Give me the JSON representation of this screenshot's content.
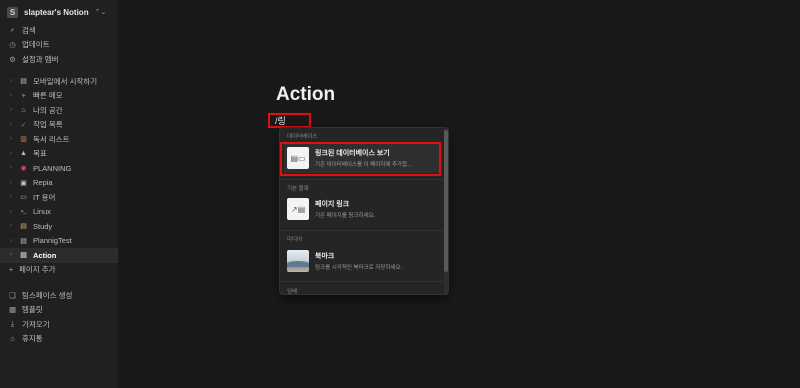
{
  "workspace": {
    "avatar_letter": "S",
    "name": "slaptear's Notion",
    "chevron": "⌃⌄"
  },
  "top_nav": [
    {
      "icon": "search-icon",
      "glyph": "⌕",
      "label": "검색"
    },
    {
      "icon": "clock-icon",
      "glyph": "◷",
      "label": "업데이트"
    },
    {
      "icon": "gear-icon",
      "glyph": "⚙",
      "label": "설정과 멤버"
    }
  ],
  "pages": [
    {
      "icon": "page-icon",
      "glyph": "▤",
      "label": "모바일에서 시작하기"
    },
    {
      "icon": "pin-icon",
      "glyph": "📌",
      "label": "빠른 메모"
    },
    {
      "icon": "house-icon",
      "glyph": "🏠",
      "label": "나의 공간"
    },
    {
      "icon": "check-icon",
      "glyph": "✓",
      "label": "작업 목록"
    },
    {
      "icon": "books-icon",
      "glyph": "📚",
      "label": "독서 리스트"
    },
    {
      "icon": "mountain-icon",
      "glyph": "⛰",
      "label": "목표"
    },
    {
      "icon": "target-icon",
      "glyph": "◉",
      "label": "PLANNING"
    },
    {
      "icon": "briefcase-icon",
      "glyph": "💼",
      "label": "Repia"
    },
    {
      "icon": "monitor-icon",
      "glyph": "🖥",
      "label": "IT 용어"
    },
    {
      "icon": "terminal-icon",
      "glyph": ">_",
      "label": "Linux"
    },
    {
      "icon": "notebook-icon",
      "glyph": "📒",
      "label": "Study"
    },
    {
      "icon": "page-icon",
      "glyph": "▤",
      "label": "PlannigTest"
    },
    {
      "icon": "page-icon",
      "glyph": "▤",
      "label": "Action",
      "active": true
    }
  ],
  "add_page_label": "페이지 추가",
  "bottom_nav": [
    {
      "icon": "layers-icon",
      "glyph": "❏",
      "label": "팀스페이스 생성"
    },
    {
      "icon": "template-icon",
      "glyph": "▦",
      "label": "템플릿"
    },
    {
      "icon": "import-icon",
      "glyph": "⤓",
      "label": "가져오기"
    },
    {
      "icon": "trash-icon",
      "glyph": "🗑",
      "label": "휴지통"
    }
  ],
  "main": {
    "title": "Action",
    "command_input": "/링"
  },
  "menu": {
    "sections": [
      {
        "label": "데이터베이스",
        "items": [
          {
            "title": "링크된 데이터베이스 보기",
            "desc": "기존 데이터베이스를 이 페이지에 추가합...",
            "thumb": "db-page-icon"
          }
        ]
      },
      {
        "label": "기본 블록",
        "items": [
          {
            "title": "페이지 링크",
            "desc": "기존 페이지를 링크하세요.",
            "thumb": "page-link-icon"
          }
        ]
      },
      {
        "label": "미디어",
        "items": [
          {
            "title": "북마크",
            "desc": "링크를 시각적인 북마크로 저장하세요.",
            "thumb": "bookmark-image"
          }
        ]
      },
      {
        "label": "임베",
        "items": []
      }
    ]
  },
  "colors": {
    "highlight": "#e01010",
    "sidebar_bg": "#202020",
    "main_bg": "#191919",
    "menu_bg": "#252525"
  }
}
